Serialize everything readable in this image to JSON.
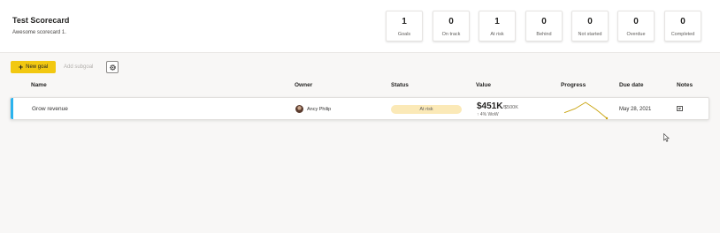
{
  "scorecard": {
    "title": "Test Scorecard",
    "description": "Awesome scorecard 1."
  },
  "stats": [
    {
      "value": "1",
      "label": "Goals"
    },
    {
      "value": "0",
      "label": "On track"
    },
    {
      "value": "1",
      "label": "At risk"
    },
    {
      "value": "0",
      "label": "Behind"
    },
    {
      "value": "0",
      "label": "Not started"
    },
    {
      "value": "0",
      "label": "Overdue"
    },
    {
      "value": "0",
      "label": "Completed"
    }
  ],
  "toolbar": {
    "new_goal": "New goal",
    "add_subgoal": "Add subgoal"
  },
  "columns": {
    "name": "Name",
    "owner": "Owner",
    "status": "Status",
    "value": "Value",
    "progress": "Progress",
    "due_date": "Due date",
    "notes": "Notes"
  },
  "goal": {
    "name": "Grow revenue",
    "owner": "Ancy Philip",
    "status": "At risk",
    "value": "$451K",
    "target": "/$500K",
    "change": "↑ 4% WoW",
    "due_date": "May 28, 2021"
  },
  "colors": {
    "accent": "#f2c811",
    "row_accent": "#2bb3ee",
    "status_at_risk": "#fbe9b7",
    "sparkline": "#c8a20a"
  },
  "progress_trend": [
    0.35,
    0.6,
    1.0,
    0.55,
    0.0
  ]
}
